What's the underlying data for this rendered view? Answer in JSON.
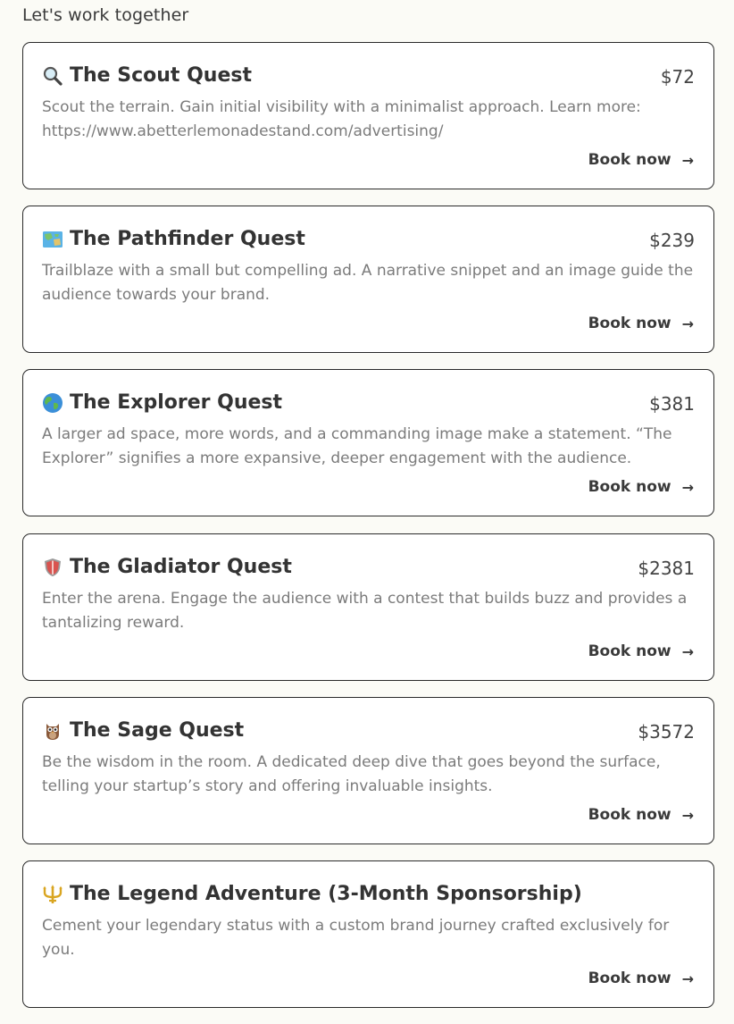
{
  "heading": "Let's work together",
  "cards": [
    {
      "icon": "magnifier-icon",
      "title": "The Scout Quest",
      "price": "$72",
      "description": "Scout the terrain. Gain initial visibility with a minimalist approach. Learn more: https://www.abetterlemonadestand.com/advertising/",
      "cta": "Book now",
      "arrow": "→"
    },
    {
      "icon": "map-icon",
      "title": "The Pathfinder Quest",
      "price": "$239",
      "description": "Trailblaze with a small but compelling ad. A narrative snippet and an image guide the audience towards your brand.",
      "cta": "Book now",
      "arrow": "→"
    },
    {
      "icon": "globe-icon",
      "title": "The Explorer Quest",
      "price": "$381",
      "description": "A larger ad space, more words, and a commanding image make a statement. “The Explorer” signifies a more expansive, deeper engagement with the audience.",
      "cta": "Book now",
      "arrow": "→"
    },
    {
      "icon": "shield-icon",
      "title": "The Gladiator Quest",
      "price": "$2381",
      "description": "Enter the arena. Engage the audience with a contest that builds buzz and provides a tantalizing reward.",
      "cta": "Book now",
      "arrow": "→"
    },
    {
      "icon": "owl-icon",
      "title": "The Sage Quest",
      "price": "$3572",
      "description": "Be the wisdom in the room. A dedicated deep dive that goes beyond the surface, telling your startup’s story and offering invaluable insights.",
      "cta": "Book now",
      "arrow": "→"
    },
    {
      "icon": "trident-icon",
      "title": "The Legend Adventure (3-Month Sponsorship)",
      "price": "",
      "description": "Cement your legendary status with a custom brand journey crafted exclusively for you.",
      "cta": "Book now",
      "arrow": "→"
    }
  ]
}
